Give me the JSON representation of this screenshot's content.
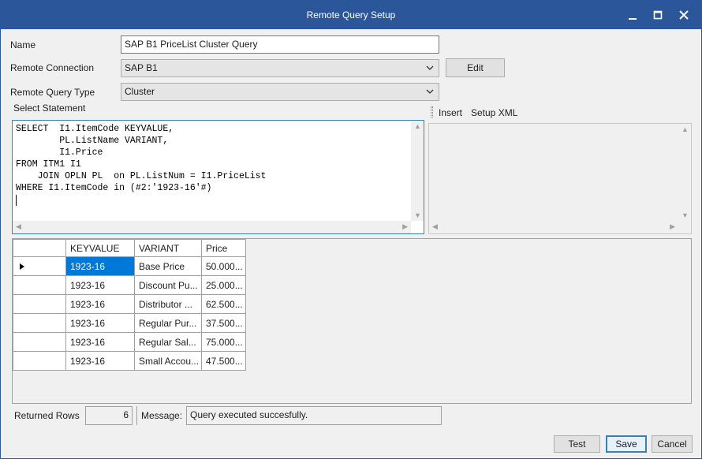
{
  "window": {
    "title": "Remote Query Setup"
  },
  "form": {
    "name_label": "Name",
    "name_value": "SAP B1 PriceList Cluster Query",
    "connection_label": "Remote Connection",
    "connection_value": "SAP B1",
    "edit_label": "Edit",
    "type_label": "Remote Query Type",
    "type_value": "Cluster",
    "select_label": "Select Statement"
  },
  "sql": {
    "text": "SELECT  I1.ItemCode KEYVALUE,\n        PL.ListName VARIANT,\n        I1.Price\nFROM ITM1 I1\n    JOIN OPLN PL  on PL.ListNum = I1.PriceList\nWHERE I1.ItemCode in (#2:'1923-16'#)"
  },
  "xml_panel": {
    "insert_label": "Insert",
    "setup_label": "Setup XML"
  },
  "grid": {
    "columns": [
      "KEYVALUE",
      "VARIANT",
      "Price"
    ],
    "rows": [
      [
        "1923-16",
        "Base Price",
        "50.000..."
      ],
      [
        "1923-16",
        "Discount Pu...",
        "25.000..."
      ],
      [
        "1923-16",
        "Distributor ...",
        "62.500..."
      ],
      [
        "1923-16",
        "Regular Pur...",
        "37.500..."
      ],
      [
        "1923-16",
        "Regular Sal...",
        "75.000..."
      ],
      [
        "1923-16",
        "Small Accou...",
        "47.500..."
      ]
    ]
  },
  "status": {
    "returned_label": "Returned Rows",
    "returned_value": "6",
    "message_label": "Message:",
    "message_value": "Query executed succesfully."
  },
  "buttons": {
    "test": "Test",
    "save": "Save",
    "cancel": "Cancel"
  },
  "colors": {
    "titlebar": "#2b579a",
    "selection": "#0078d7",
    "focus_border": "#3c7fb1"
  }
}
